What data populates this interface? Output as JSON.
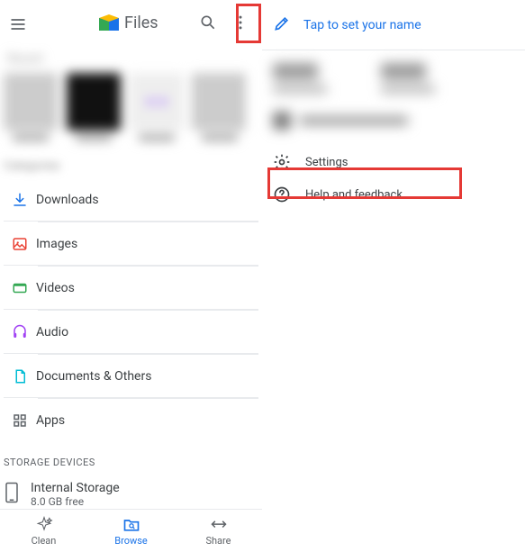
{
  "app": {
    "title": "Files"
  },
  "blur": {
    "section_label": "Recent",
    "categories_label": "Categories"
  },
  "categories": [
    {
      "label": "Downloads"
    },
    {
      "label": "Images"
    },
    {
      "label": "Videos"
    },
    {
      "label": "Audio"
    },
    {
      "label": "Documents & Others"
    },
    {
      "label": "Apps"
    }
  ],
  "storage": {
    "header": "STORAGE DEVICES",
    "internal": {
      "name": "Internal Storage",
      "sub": "8.0 GB free"
    }
  },
  "nav": {
    "clean": "Clean",
    "browse": "Browse",
    "share": "Share"
  },
  "right": {
    "tap_text": "Tap to set your name",
    "settings": "Settings",
    "help": "Help and feedback"
  }
}
